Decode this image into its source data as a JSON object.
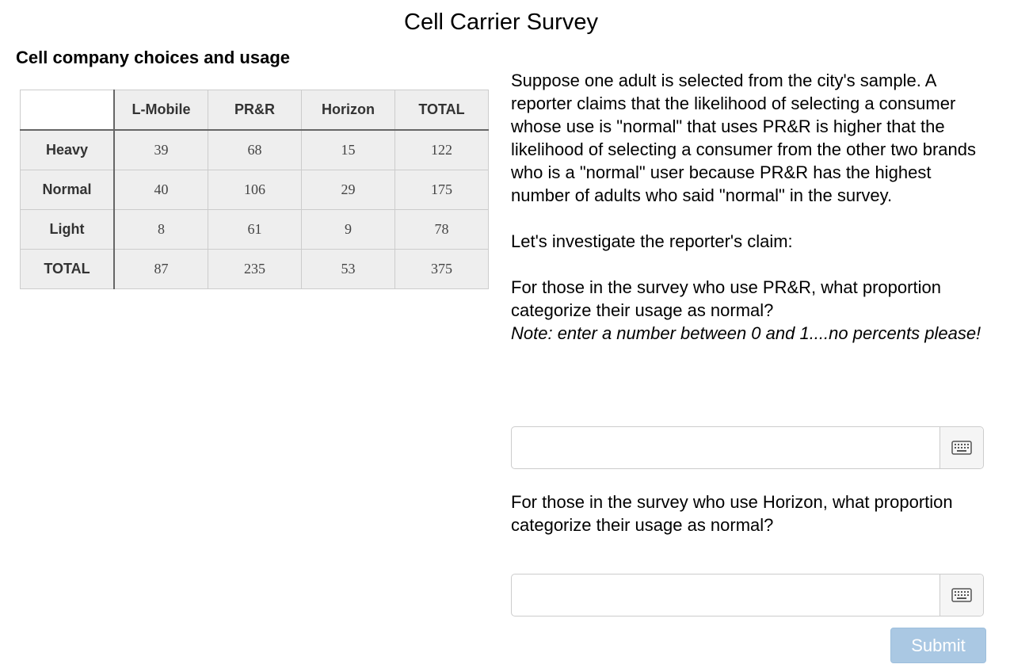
{
  "page": {
    "title": "Cell Carrier Survey"
  },
  "table": {
    "heading": "Cell company choices and usage",
    "columns": [
      "",
      "L-Mobile",
      "PR&R",
      "Horizon",
      "TOTAL"
    ],
    "rows": [
      {
        "label": "Heavy",
        "values": [
          "39",
          "68",
          "15",
          "122"
        ]
      },
      {
        "label": "Normal",
        "values": [
          "40",
          "106",
          "29",
          "175"
        ]
      },
      {
        "label": "Light",
        "values": [
          "8",
          "61",
          "9",
          "78"
        ]
      },
      {
        "label": "TOTAL",
        "values": [
          "87",
          "235",
          "53",
          "375"
        ]
      }
    ]
  },
  "intro": {
    "paragraph": "Suppose one adult is selected from the city's sample. A reporter claims that the likelihood of selecting a consumer whose use is \"normal\" that uses PR&R is higher that the likelihood of selecting a consumer from the other two brands who is a \"normal\" user because PR&R has the highest number of adults who said \"normal\" in the survey.",
    "investigate": "Let's investigate the reporter's claim:"
  },
  "question1": {
    "text": "For those in the survey who use PR&R, what proportion categorize their usage as normal?",
    "note": "Note: enter a number between 0 and 1....no percents please!",
    "value": ""
  },
  "question2": {
    "text": "For those in the survey who use Horizon, what proportion categorize their usage as normal?",
    "value": ""
  },
  "icons": {
    "keyboard": "keyboard-icon"
  },
  "submit": {
    "label": "Submit",
    "color": "#aac8e3"
  }
}
